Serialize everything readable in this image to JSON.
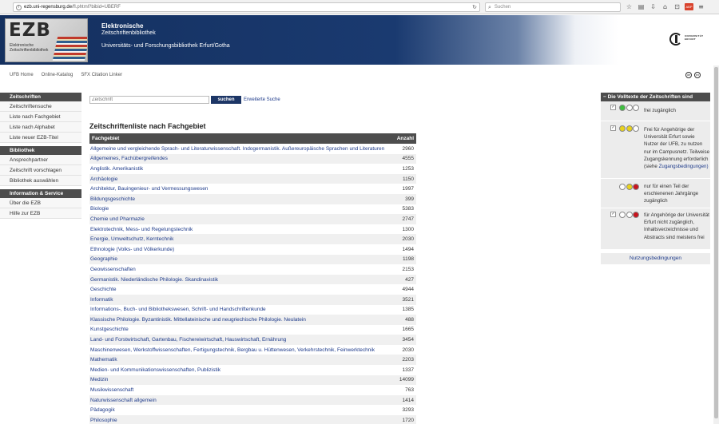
{
  "browser": {
    "url_host": "ezb.uni-regensburg.de",
    "url_path": "/fl.phtml?bibid=UBERF",
    "search_placeholder": "Suchen",
    "icons": [
      "star-icon",
      "clipboard-icon",
      "download-icon",
      "home-icon",
      "lock-icon",
      "adblock-icon",
      "menu-icon"
    ],
    "adblock_label": "ABP"
  },
  "banner": {
    "logo_text": "EZB",
    "logo_subtext": "Elektronische Zeitschriftenbibliothek",
    "title_line1": "Elektronische",
    "title_line2": "Zeitschriftenbibliothek",
    "institution": "Universitäts- und Forschungsbibliothek Erfurt/Gotha",
    "uni_logo_text": "UNIVERSITÄT ERFURT"
  },
  "subnav": {
    "links": [
      "UFB Home",
      "Online-Katalog",
      "SFX Citation Linker"
    ]
  },
  "lang_icons": [
    "de",
    "en"
  ],
  "sidebar": {
    "sections": [
      {
        "title": "Zeitschriften",
        "items": [
          "Zeitschriftensuche",
          "Liste nach Fachgebiet",
          "Liste nach Alphabet",
          "Liste neuer EZB-Titel"
        ]
      },
      {
        "title": "Bibliothek",
        "items": [
          "Ansprechpartner",
          "Zeitschrift vorschlagen",
          "Bibliothek auswählen"
        ]
      },
      {
        "title": "Information & Service",
        "items": [
          "Über die EZB",
          "Hilfe zur EZB"
        ]
      }
    ]
  },
  "search": {
    "placeholder": "Zeitschrift",
    "button_label": "suchen",
    "advanced_link": "Erweiterte Suche"
  },
  "list": {
    "title": "Zeitschriftenliste nach Fachgebiet",
    "col_subject": "Fachgebiet",
    "col_count": "Anzahl",
    "rows": [
      {
        "name": "Allgemeine und vergleichende Sprach- und Literaturwissenschaft. Indogermanistik. Außereuropäische Sprachen und Literaturen",
        "count": "2960"
      },
      {
        "name": "Allgemeines, Fachübergreifendes",
        "count": "4555"
      },
      {
        "name": "Anglistik. Amerikanistik",
        "count": "1253"
      },
      {
        "name": "Archäologie",
        "count": "1150"
      },
      {
        "name": "Architektur, Bauingenieur- und Vermessungswesen",
        "count": "1997"
      },
      {
        "name": "Bildungsgeschichte",
        "count": "399"
      },
      {
        "name": "Biologie",
        "count": "5383"
      },
      {
        "name": "Chemie und Pharmazie",
        "count": "2747"
      },
      {
        "name": "Elektrotechnik, Mess- und Regelungstechnik",
        "count": "1300"
      },
      {
        "name": "Energie, Umweltschutz, Kerntechnik",
        "count": "2030"
      },
      {
        "name": "Ethnologie (Volks- und Völkerkunde)",
        "count": "1494"
      },
      {
        "name": "Geographie",
        "count": "1198"
      },
      {
        "name": "Geowissenschaften",
        "count": "2153"
      },
      {
        "name": "Germanistik. Niederländische Philologie. Skandinavistik",
        "count": "427"
      },
      {
        "name": "Geschichte",
        "count": "4944"
      },
      {
        "name": "Informatik",
        "count": "3521"
      },
      {
        "name": "Informations-, Buch- und Bibliothekswesen, Schrift- und Handschriftenkunde",
        "count": "1385"
      },
      {
        "name": "Klassische Philologie. Byzantinistik. Mittellateinische und neugriechische Philologie. Neulatein",
        "count": "488"
      },
      {
        "name": "Kunstgeschichte",
        "count": "1665"
      },
      {
        "name": "Land- und Forstwirtschaft, Gartenbau, Fischereiwirtschaft, Hauswirtschaft, Ernährung",
        "count": "3454"
      },
      {
        "name": "Maschinenwesen, Werkstoffwissenschaften, Fertigungstechnik, Bergbau u. Hüttenwesen, Verkehrstechnik, Feinwerktechnik",
        "count": "2030"
      },
      {
        "name": "Mathematik",
        "count": "2203"
      },
      {
        "name": "Medien- und Kommunikationswissenschaften, Publizistik",
        "count": "1337"
      },
      {
        "name": "Medizin",
        "count": "14099"
      },
      {
        "name": "Musikwissenschaft",
        "count": "763"
      },
      {
        "name": "Naturwissenschaft allgemein",
        "count": "1414"
      },
      {
        "name": "Pädagogik",
        "count": "3293"
      },
      {
        "name": "Philosophie",
        "count": "1720"
      }
    ]
  },
  "legend": {
    "title": "Die Volltexte der Zeitschriften sind",
    "entries": [
      {
        "lights": [
          "green",
          "off",
          "off"
        ],
        "checked": true,
        "text": "frei zugänglich",
        "link": ""
      },
      {
        "lights": [
          "yellow",
          "yellow",
          "off"
        ],
        "checked": true,
        "text": "Frei für Angehörige der Universität Erfurt sowie Nutzer der UFB, zu nutzen nur im Campusnetz. Teilweise Zugangskennung erforderlich (siehe",
        "link": "Zugangsbedingungen)"
      },
      {
        "lights": [
          "off",
          "yellow",
          "red"
        ],
        "checked": false,
        "text": "nur für einen Teil der erschienenen Jahrgänge zugänglich",
        "link": ""
      },
      {
        "lights": [
          "off",
          "off",
          "red"
        ],
        "checked": true,
        "text": "für Angehörige der Universität Erfurt nicht zugänglich, Inhaltsverzeichnisse und Abstracts sind meistens frei",
        "link": ""
      }
    ],
    "footer_link": "Nutzungsbedingungen",
    "colors": {
      "green": "#3fbf3f",
      "yellow": "#e8d21d",
      "red": "#c8141e",
      "off": "#ffffff"
    }
  },
  "colors": {
    "banner_dark": "#14305f",
    "sidebar_head": "#4d4d4d",
    "link": "#1d3a8a",
    "button": "#1d3666"
  }
}
